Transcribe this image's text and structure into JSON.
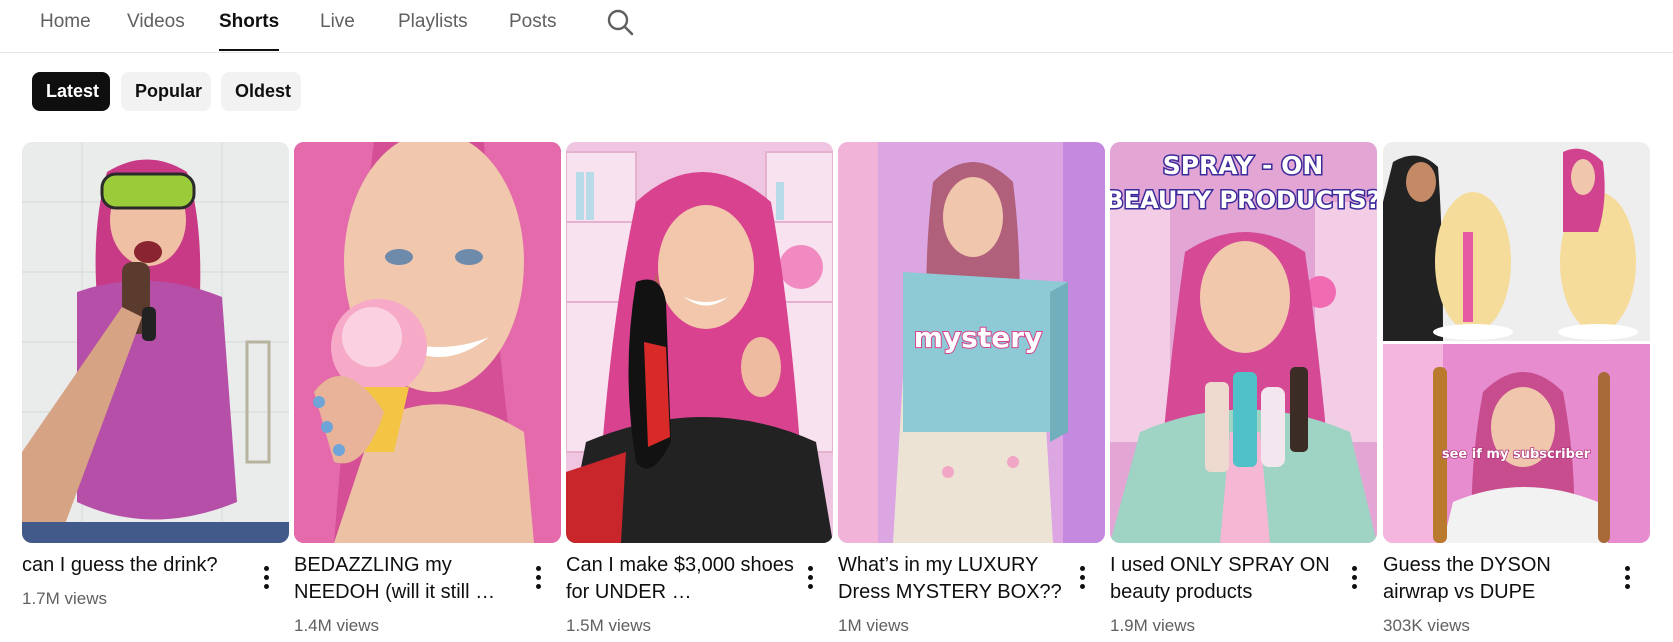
{
  "tabs": [
    {
      "label": "Home"
    },
    {
      "label": "Videos"
    },
    {
      "label": "Shorts"
    },
    {
      "label": "Live"
    },
    {
      "label": "Playlists"
    },
    {
      "label": "Posts"
    }
  ],
  "active_tab": "Shorts",
  "filters": [
    {
      "label": "Latest",
      "selected": true
    },
    {
      "label": "Popular",
      "selected": false
    },
    {
      "label": "Oldest",
      "selected": false
    }
  ],
  "shorts": [
    {
      "title": "can I guess the drink?",
      "views": "1.7M views"
    },
    {
      "title": "BEDAZZLING my NEEDOH (will it still …",
      "views": "1.4M views"
    },
    {
      "title": "Can I make $3,000 shoes for UNDER …",
      "views": "1.5M views"
    },
    {
      "title": "What’s in my LUXURY Dress MYSTERY BOX??",
      "views": "1M views"
    },
    {
      "title": "I used ONLY SPRAY ON beauty products",
      "views": "1.9M views"
    },
    {
      "title": "Guess the DYSON airwrap vs DUPE",
      "views": "303K views"
    }
  ],
  "thumbnail_text": {
    "mystery": "mystery",
    "spray_line1": "SPRAY - ON",
    "spray_line2": "BEAUTY PRODUCTS?",
    "subscriber": "see if my subscriber"
  },
  "colors": {
    "text_primary": "#0f0f0f",
    "text_secondary": "#606060",
    "chip_bg": "#f2f2f2",
    "chip_selected_bg": "#0f0f0f",
    "hair_pink": "#e0468f"
  }
}
